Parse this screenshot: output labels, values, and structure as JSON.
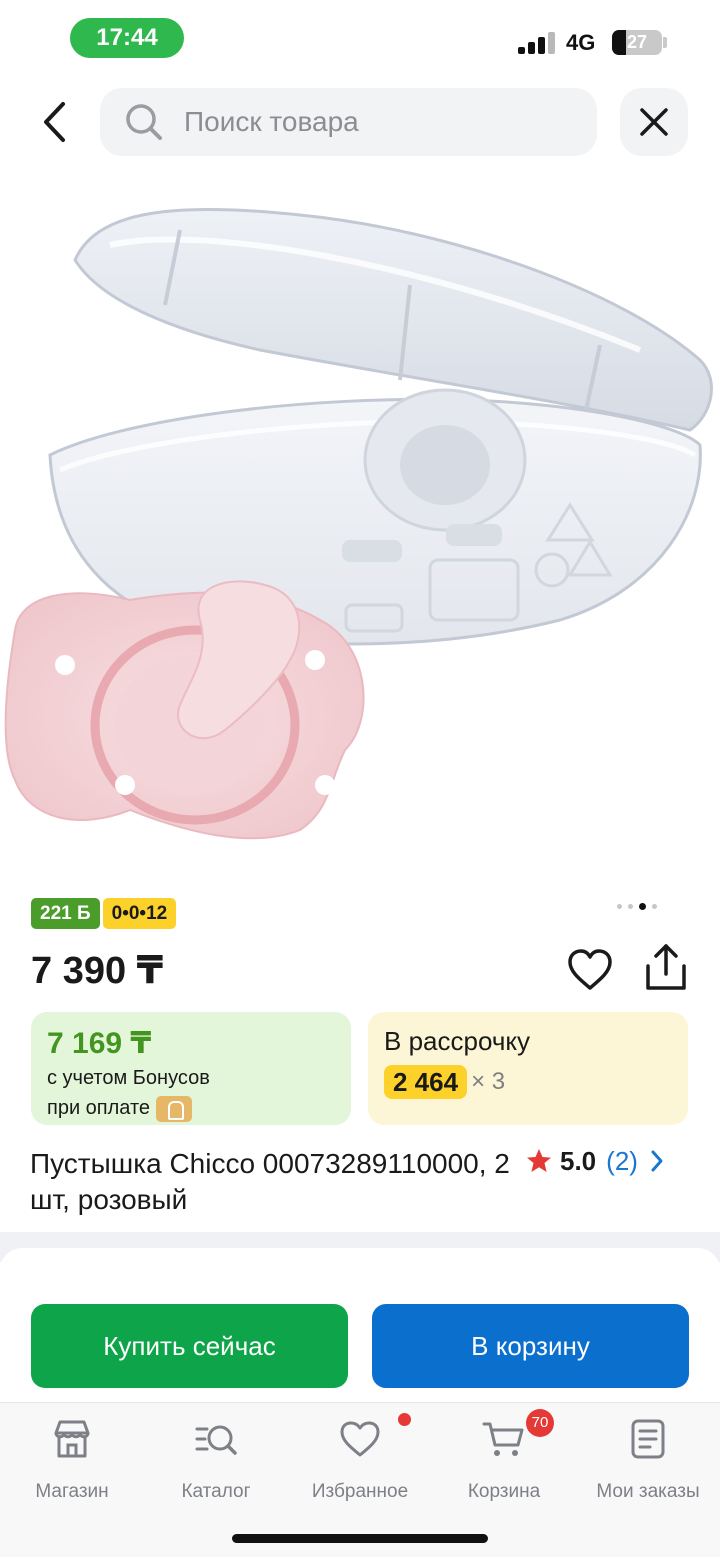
{
  "status_bar": {
    "time": "17:44",
    "network": "4G",
    "battery": "27",
    "battery_level": 0.27
  },
  "search": {
    "placeholder": "Поиск товара",
    "back_icon": "chevron-left-icon",
    "search_icon": "search-icon",
    "clear_icon": "close-icon"
  },
  "product": {
    "image_description": "pacifier-with-case",
    "image_dots": 4,
    "active_image_dot": 3,
    "badges": {
      "bonus": "221 Б",
      "installment_plan": "0•0•12"
    },
    "price": "7 390 ₸",
    "bonus_card": {
      "price": "7 169 ₸",
      "line1": "с учетом Бонусов",
      "line2": "при оплате"
    },
    "installment_card": {
      "title": "В рассрочку",
      "amount": "2 464",
      "multiplier": "× 3"
    },
    "title": "Пустышка Chicco 00073289110000, 2 шт, розовый",
    "rating": {
      "value": "5.0",
      "count": "(2)"
    }
  },
  "actions": {
    "buy_now": "Купить сейчас",
    "add_to_cart": "В корзину"
  },
  "tabbar": {
    "items": [
      {
        "label": "Магазин",
        "icon": "shop-icon"
      },
      {
        "label": "Каталог",
        "icon": "catalog-search-icon"
      },
      {
        "label": "Избранное",
        "icon": "heart-icon"
      },
      {
        "label": "Корзина",
        "icon": "cart-icon"
      },
      {
        "label": "Мои заказы",
        "icon": "orders-icon"
      }
    ],
    "cart_count": "70"
  },
  "colors": {
    "status_green": "#2eb84e",
    "buy_now_green": "#0ea54a",
    "cart_blue": "#0b6fce",
    "bonus_green": "#43951f",
    "installment_yellow": "#fcd12a",
    "rating_star": "#e53935"
  }
}
